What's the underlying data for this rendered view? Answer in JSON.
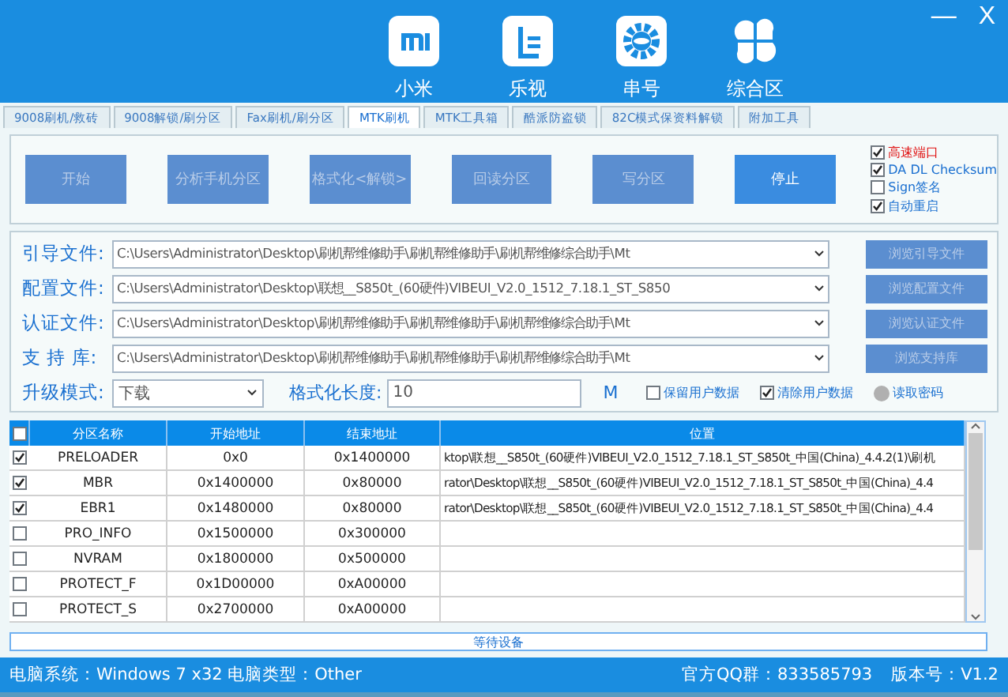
{
  "window_controls": [
    "—",
    "X"
  ],
  "nav": [
    {
      "label": "小米",
      "kind": "mi"
    },
    {
      "label": "乐视",
      "kind": "le"
    },
    {
      "label": "串号",
      "kind": "gear"
    },
    {
      "label": "综合区",
      "kind": "clover"
    }
  ],
  "tabs": [
    {
      "label": "9008刷机/救砖",
      "selected": false
    },
    {
      "label": "9008解锁/刷分区",
      "selected": false
    },
    {
      "label": "Fax刷机/刷分区",
      "selected": false
    },
    {
      "label": "MTK刷机",
      "selected": true
    },
    {
      "label": "MTK工具箱",
      "selected": false
    },
    {
      "label": "酷派防盗锁",
      "selected": false
    },
    {
      "label": "82C模式保资料解锁",
      "selected": false
    },
    {
      "label": "附加工具",
      "selected": false
    }
  ],
  "actions": [
    {
      "label": "开始",
      "disabled": true
    },
    {
      "label": "分析手机分区",
      "disabled": true
    },
    {
      "label": "格式化<解锁>",
      "disabled": true
    },
    {
      "label": "回读分区",
      "disabled": true
    },
    {
      "label": "写分区",
      "disabled": true
    },
    {
      "label": "停止",
      "disabled": false
    }
  ],
  "options": [
    {
      "label": "高速端口",
      "checked": true,
      "color": "#e01010"
    },
    {
      "label": "DA DL Checksum",
      "checked": true,
      "color": "#1a6fd0"
    },
    {
      "label": "Sign签名",
      "checked": false,
      "color": "#1a6fd0"
    },
    {
      "label": "自动重启",
      "checked": true,
      "color": "#1a6fd0"
    }
  ],
  "files": [
    {
      "label": "引导文件:",
      "value": "C:\\Users\\Administrator\\Desktop\\刷机帮维修助手\\刷机帮维修助手\\刷机帮维修综合助手\\Mt",
      "button": "浏览引导文件"
    },
    {
      "label": "配置文件:",
      "value": "C:\\Users\\Administrator\\Desktop\\联想__S850t_(60硬件)VIBEUI_V2.0_1512_7.18.1_ST_S850",
      "button": "浏览配置文件"
    },
    {
      "label": "认证文件:",
      "value": "C:\\Users\\Administrator\\Desktop\\刷机帮维修助手\\刷机帮维修助手\\刷机帮维修综合助手\\Mt",
      "button": "浏览认证文件"
    },
    {
      "label": "支 持 库:",
      "value": "C:\\Users\\Administrator\\Desktop\\刷机帮维修助手\\刷机帮维修助手\\刷机帮维修综合助手\\Mt",
      "button": "浏览支持库"
    }
  ],
  "mode": {
    "label": "升级模式:",
    "value": "下载"
  },
  "format_length": {
    "label": "格式化长度:",
    "value": "10",
    "unit": "M"
  },
  "data_options": [
    {
      "label": "保留用户数据",
      "checked": false,
      "kind": "checkbox"
    },
    {
      "label": "清除用户数据",
      "checked": true,
      "kind": "checkbox"
    },
    {
      "label": "读取密码",
      "checked": false,
      "kind": "radio"
    }
  ],
  "table": {
    "all_checked": false,
    "columns": [
      "分区名称",
      "开始地址",
      "结束地址",
      "位置"
    ],
    "rows": [
      {
        "checked": true,
        "cells": [
          "PRELOADER",
          "0x0",
          "0x1400000",
          "ktop\\联想__S850t_(60硬件)VIBEUI_V2.0_1512_7.18.1_ST_S850t_中国(China)_4.4.2(1)\\刷机"
        ]
      },
      {
        "checked": true,
        "cells": [
          "MBR",
          "0x1400000",
          "0x80000",
          "rator\\Desktop\\联想__S850t_(60硬件)VIBEUI_V2.0_1512_7.18.1_ST_S850t_中国(China)_4.4"
        ]
      },
      {
        "checked": true,
        "cells": [
          "EBR1",
          "0x1480000",
          "0x80000",
          "rator\\Desktop\\联想__S850t_(60硬件)VIBEUI_V2.0_1512_7.18.1_ST_S850t_中国(China)_4.4"
        ]
      },
      {
        "checked": false,
        "cells": [
          "PRO_INFO",
          "0x1500000",
          "0x300000",
          ""
        ]
      },
      {
        "checked": false,
        "cells": [
          "NVRAM",
          "0x1800000",
          "0x500000",
          ""
        ]
      },
      {
        "checked": false,
        "cells": [
          "PROTECT_F",
          "0x1D00000",
          "0xA00000",
          ""
        ]
      },
      {
        "checked": false,
        "cells": [
          "PROTECT_S",
          "0x2700000",
          "0xA00000",
          ""
        ]
      }
    ]
  },
  "status": "等待设备",
  "footer": {
    "left": "电脑系统：Windows 7 x32 电脑类型：Other",
    "right": [
      "官方QQ群：833585793",
      "版本号：V1.2"
    ]
  }
}
